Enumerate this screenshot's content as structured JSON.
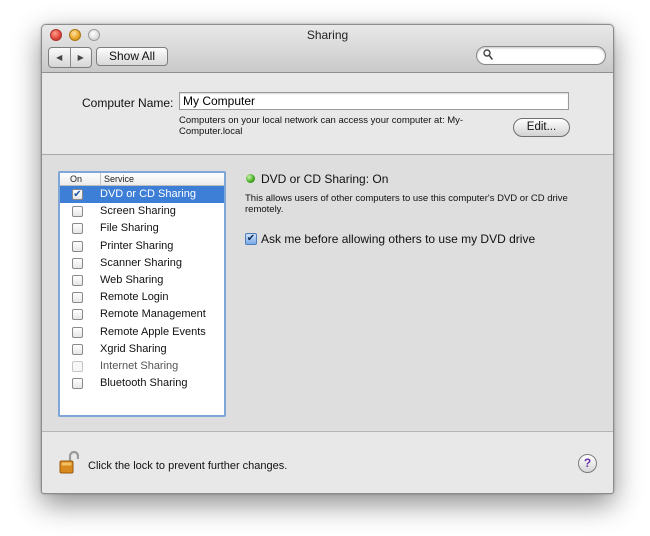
{
  "window": {
    "title": "Sharing"
  },
  "toolbar": {
    "back_glyph": "◀",
    "forward_glyph": "▶",
    "show_all_label": "Show All",
    "search_placeholder": "",
    "search_icon": "magnifier-icon"
  },
  "computer": {
    "label": "Computer Name:",
    "name": "My Computer",
    "description": "Computers on your local network can access your computer at: My-Computer.local",
    "edit_label": "Edit..."
  },
  "services": {
    "header_on": "On",
    "header_service": "Service",
    "items": [
      {
        "label": "DVD or CD Sharing",
        "checked": true,
        "selected": true,
        "enabled": true
      },
      {
        "label": "Screen Sharing",
        "checked": false,
        "selected": false,
        "enabled": true
      },
      {
        "label": "File Sharing",
        "checked": false,
        "selected": false,
        "enabled": true
      },
      {
        "label": "Printer Sharing",
        "checked": false,
        "selected": false,
        "enabled": true
      },
      {
        "label": "Scanner Sharing",
        "checked": false,
        "selected": false,
        "enabled": true
      },
      {
        "label": "Web Sharing",
        "checked": false,
        "selected": false,
        "enabled": true
      },
      {
        "label": "Remote Login",
        "checked": false,
        "selected": false,
        "enabled": true
      },
      {
        "label": "Remote Management",
        "checked": false,
        "selected": false,
        "enabled": true
      },
      {
        "label": "Remote Apple Events",
        "checked": false,
        "selected": false,
        "enabled": true
      },
      {
        "label": "Xgrid Sharing",
        "checked": false,
        "selected": false,
        "enabled": true
      },
      {
        "label": "Internet Sharing",
        "checked": false,
        "selected": false,
        "enabled": false
      },
      {
        "label": "Bluetooth Sharing",
        "checked": false,
        "selected": false,
        "enabled": true
      }
    ]
  },
  "detail": {
    "status_title": "DVD or CD Sharing: On",
    "status_color": "#3fa81d",
    "description": "This allows users of other computers to use this computer's DVD or CD drive remotely.",
    "option_label": "Ask me before allowing others to use my DVD drive",
    "option_checked": true
  },
  "footer": {
    "lock_text": "Click the lock to prevent further changes.",
    "lock_icon": "unlocked-padlock-icon",
    "help_glyph": "?"
  }
}
